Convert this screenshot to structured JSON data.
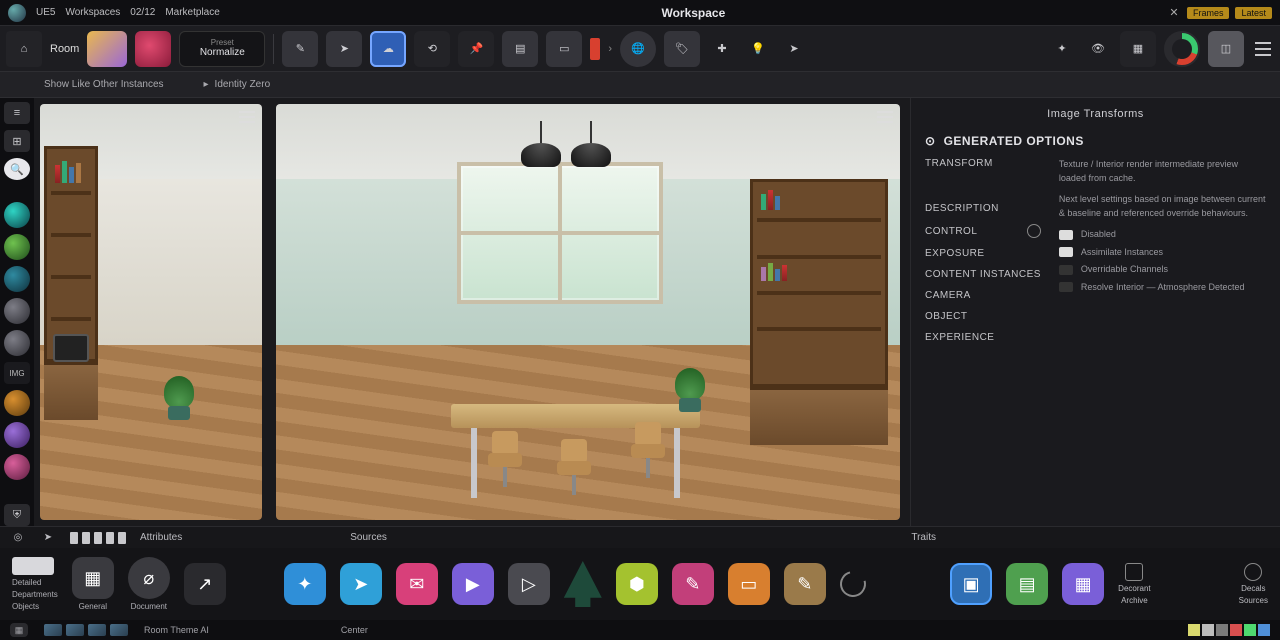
{
  "titlebar": {
    "app": "UE5",
    "menu_a": "Workspaces",
    "menu_b": "02/12",
    "menu_c": "Marketplace",
    "center": "Workspace",
    "badge_a": "Frames",
    "badge_b": "Latest"
  },
  "toolbar": {
    "label_home": "Room",
    "drop_mode": "Normalize",
    "drop_prefix": "Preset"
  },
  "subheader": {
    "a": "Show Like Other Instances",
    "b": "Identity Zero"
  },
  "inspector": {
    "header": "Image Transforms",
    "section": "GENERATED OPTIONS",
    "rows": [
      "TRANSFORM",
      "DESCRIPTION",
      "CONTROL",
      "EXPOSURE",
      "CONTENT INSTANCES",
      "CAMERA",
      "OBJECT",
      "EXPERIENCE"
    ],
    "para1": "Texture / Interior render intermediate preview loaded from cache.",
    "para2": "Next level settings based on image between current & baseline and referenced override behaviours.",
    "list": [
      "Disabled",
      "Assimilate Instances",
      "Overridable Channels",
      "Resolve Interior — Atmosphere Detected"
    ]
  },
  "strip_head": {
    "left": "Attributes",
    "mid": "Sources",
    "right": "Traits"
  },
  "assets": {
    "blk_a": "General",
    "blk_b": "Document",
    "col_a": "Detailed",
    "col_b": "Departments",
    "col_c": "Objects",
    "side_a": "Decorant",
    "side_b": "Archive",
    "side_c": "Decals",
    "side_d": "Sources"
  },
  "footer": {
    "a": "Room Theme AI",
    "b": "Center",
    "swatches": [
      "#d9d96f",
      "#bcbcbc",
      "#7a7a7a",
      "#d84f4f",
      "#4fd86f",
      "#4f8fd8"
    ]
  }
}
